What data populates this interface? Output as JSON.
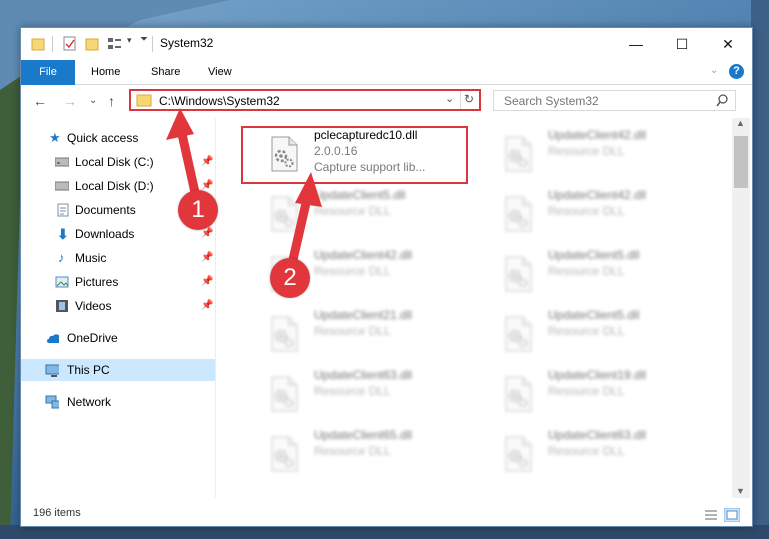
{
  "window": {
    "title": "System32",
    "minimize": "—",
    "maximize": "☐",
    "close": "✕"
  },
  "ribbon": {
    "tabs": [
      "File",
      "Home",
      "Share",
      "View"
    ],
    "help": "?"
  },
  "address": {
    "path": "C:\\Windows\\System32"
  },
  "search": {
    "placeholder": "Search System32"
  },
  "nav": {
    "items": [
      {
        "label": "Quick access",
        "icon": "star-icon"
      },
      {
        "label": "Local Disk (C:)",
        "icon": "drive-icon",
        "pinned": true
      },
      {
        "label": "Local Disk (D:)",
        "icon": "drive-icon",
        "pinned": true
      },
      {
        "label": "Documents",
        "icon": "documents-icon",
        "pinned": true
      },
      {
        "label": "Downloads",
        "icon": "downloads-icon",
        "pinned": true
      },
      {
        "label": "Music",
        "icon": "music-icon",
        "pinned": true
      },
      {
        "label": "Pictures",
        "icon": "pictures-icon",
        "pinned": true
      },
      {
        "label": "Videos",
        "icon": "videos-icon",
        "pinned": true
      },
      {
        "label": "OneDrive",
        "icon": "cloud-icon"
      },
      {
        "label": "This PC",
        "icon": "computer-icon",
        "selected": true
      },
      {
        "label": "Network",
        "icon": "network-icon"
      }
    ]
  },
  "files": [
    {
      "name": "pclecapturedc10.dll",
      "line2": "2.0.0.16",
      "line3": "Capture support lib...",
      "highlight": true
    },
    {
      "name": "UpdateClient42.dll",
      "line2": "Resource DLL"
    },
    {
      "name": "UpdateClient5.dll",
      "line2": "Resource DLL"
    },
    {
      "name": "UpdateClient42.dll",
      "line2": "Resource DLL"
    },
    {
      "name": "UpdateClient42.dll",
      "line2": "Resource DLL"
    },
    {
      "name": "UpdateClient5.dll",
      "line2": "Resource DLL"
    },
    {
      "name": "UpdateClient21.dll",
      "line2": "Resource DLL"
    },
    {
      "name": "UpdateClient5.dll",
      "line2": "Resource DLL"
    },
    {
      "name": "UpdateClient63.dll",
      "line2": "Resource DLL"
    },
    {
      "name": "UpdateClient19.dll",
      "line2": "Resource DLL"
    },
    {
      "name": "UpdateClient65.dll",
      "line2": "Resource DLL"
    },
    {
      "name": "UpdateClient63.dll",
      "line2": "Resource DLL"
    }
  ],
  "status": {
    "count": "196 items"
  },
  "annotations": [
    "1",
    "2"
  ],
  "colors": {
    "accent": "#1979ca",
    "highlight": "#d9363e",
    "selected": "#cce8ff"
  }
}
